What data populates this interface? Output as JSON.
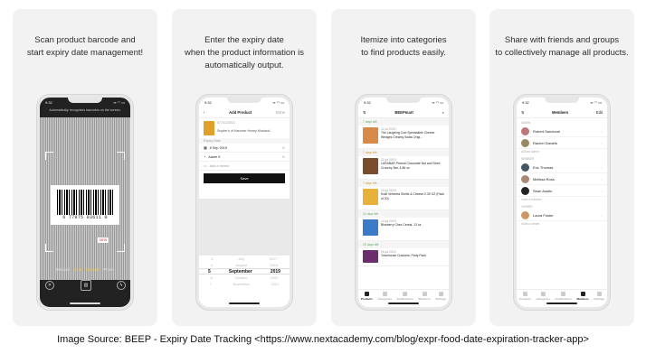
{
  "panels": [
    {
      "caption_line1": "Scan product barcode and",
      "caption_line2": "start expiry date management!"
    },
    {
      "caption_line1": "Enter the expiry date",
      "caption_line2": "when the product information is",
      "caption_line3": "automatically output."
    },
    {
      "caption_line1": "Itemize into categories",
      "caption_line2": "to find products easily."
    },
    {
      "caption_line1": "Share with friends and groups",
      "caption_line2": "to collectively manage all products."
    }
  ],
  "scan": {
    "time": "9:32",
    "hint": "Automatically recognizes barcodes on the screen.",
    "barcode_number": "6 77975 03611 0",
    "badge": "NEW",
    "modes": [
      "Manual",
      "Scan barcode",
      "Photo"
    ]
  },
  "add": {
    "time": "9:32",
    "title": "Add Product",
    "done": "Done",
    "product_code": "0774123031",
    "product_name": "Snyder's of Hanover Honey Mustard...",
    "expiry_label": "Expiry Date",
    "date": "8 Sep 2019",
    "alarm": "Alarm 5",
    "memo_placeholder": "Add a memo",
    "save": "Save",
    "picker_rows": [
      [
        "1",
        "July",
        "2017"
      ],
      [
        "4",
        "August",
        "2018"
      ],
      [
        "5",
        "September",
        "2019"
      ],
      [
        "6",
        "October",
        "2020"
      ],
      [
        "7",
        "November",
        "2021"
      ]
    ]
  },
  "list": {
    "time": "9:32",
    "title": "BEEPmart",
    "sections": [
      {
        "label": "7 days left",
        "items": [
          {
            "date": "11 jul 2019",
            "name": "The Laughing Cow Spreadable Cheese Wedges Creamy Swiss Origi...",
            "code": "0774123031"
          }
        ]
      },
      {
        "label": "7 days left",
        "items": [
          {
            "date": "22 jul 2019",
            "name": "LARABAR Peanut Chocolate Nut and Seed Crunchy Bar, 4.86 oz",
            "code": "0774123031"
          }
        ]
      },
      {
        "label": "7 days left",
        "items": [
          {
            "date": "23 jul 2019",
            "name": "Kraft Velveeta Shells & Cheese 2.39 OZ (Pack of 20)",
            "code": "0774123031"
          }
        ]
      },
      {
        "label": "11 days left",
        "items": [
          {
            "date": "14 jul 2019",
            "name": "Blueberry Chex Cereal, 13 oz",
            "code": "0774123031"
          }
        ]
      },
      {
        "label": "25 days left",
        "items": [
          {
            "date": "26 jul 2019",
            "name": "Townhouse Crackers, Party Pack",
            "code": "0774123031"
          }
        ]
      }
    ],
    "tabs": [
      "Products",
      "Categories",
      "Notifications",
      "Members",
      "Settings"
    ]
  },
  "members": {
    "time": "9:32",
    "title": "Members",
    "edit": "Edit",
    "groups": [
      {
        "label": "ADMIN",
        "people": [
          "Robert Sandoval",
          "Rachel Daniels"
        ],
        "add": "Add an admin"
      },
      {
        "label": "MEMBER",
        "people": [
          "Eric Thomas",
          "Melissa Ross",
          "Sean Austin"
        ],
        "add": "Invite a member"
      },
      {
        "label": "VIEWER",
        "people": [
          "Laura Foster"
        ],
        "add": "Invite a viewer"
      }
    ],
    "tabs": [
      "Products",
      "Categories",
      "Notifications",
      "Members",
      "Settings"
    ]
  },
  "footer": "Image Source: BEEP - Expiry Date Tracking <https://www.nextacademy.com/blog/expr-food-date-expiration-tracker-app>"
}
